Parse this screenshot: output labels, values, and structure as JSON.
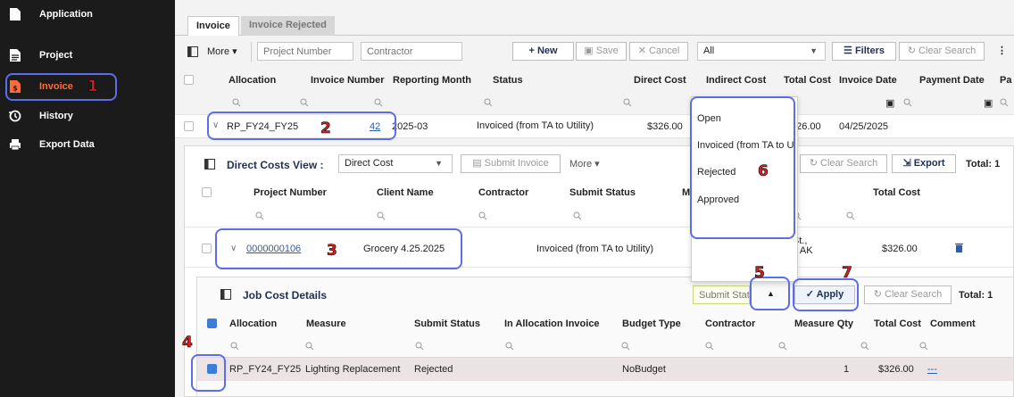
{
  "sidebar": {
    "items": [
      {
        "label": "Application",
        "icon": "document-icon"
      },
      {
        "label": "Project",
        "icon": "document-lines-icon"
      },
      {
        "label": "Invoice",
        "icon": "invoice-icon",
        "active": true
      },
      {
        "label": "History",
        "icon": "history-icon"
      },
      {
        "label": "Export Data",
        "icon": "export-icon"
      }
    ]
  },
  "tabs": [
    {
      "label": "Invoice"
    },
    {
      "label": "Invoice Rejected"
    }
  ],
  "toolbar": {
    "more": "More",
    "project_placeholder": "Project Number",
    "contractor_placeholder": "Contractor",
    "new": "New",
    "save": "Save",
    "cancel": "Cancel",
    "filter_select": "All",
    "filters": "Filters",
    "clear_search": "Clear Search"
  },
  "grid": {
    "headers": [
      "Allocation",
      "Invoice Number",
      "Reporting Month",
      "Status",
      "Direct Cost",
      "Indirect Cost",
      "Total Cost",
      "Invoice Date",
      "Payment Date",
      "Pa"
    ],
    "row": {
      "allocation": "RP_FY24_FY25",
      "invoice_number": "42",
      "reporting_month": "2025-03",
      "status": "Invoiced (from TA to Utility)",
      "direct_cost": "$326.00",
      "total_cost": "326.00",
      "invoice_date": "04/25/2025"
    }
  },
  "direct_costs": {
    "title": "Direct Costs View :",
    "view_select": "Direct Cost",
    "submit_invoice": "Submit Invoice",
    "more": "More",
    "clear_search": "Clear Search",
    "export": "Export",
    "total": "Total: 1",
    "headers": [
      "Project Number",
      "Client Name",
      "Contractor",
      "Submit Status",
      "M",
      "s",
      "Total Cost"
    ],
    "row": {
      "project_number": "0000000106",
      "client_name": "Grocery 4.25.2025",
      "submit_status": "Invoiced (from TA to Utility)",
      "address_line1": "rth St.,",
      "address_line2": "een, AK",
      "total_cost": "$326.00"
    }
  },
  "job_cost": {
    "title": "Job Cost Details",
    "status_placeholder": "Submit Statu",
    "apply": "Apply",
    "clear_search": "Clear Search",
    "total": "Total: 1",
    "headers": [
      "Allocation",
      "Measure",
      "Submit Status",
      "In Allocation Invoice",
      "Budget Type",
      "Contractor",
      "Measure Qty",
      "Total Cost",
      "Comment"
    ],
    "row": {
      "allocation": "RP_FY24_FY25",
      "measure": "Lighting Replacement",
      "submit_status": "Rejected",
      "budget_type": "NoBudget",
      "measure_qty": "1",
      "total_cost": "$326.00",
      "comment": "---"
    }
  },
  "dropdown": {
    "options": [
      "Open",
      "Invoiced (from TA to Ut",
      "Rejected",
      "Approved"
    ]
  },
  "annotations": [
    "1",
    "2",
    "3",
    "4",
    "5",
    "6",
    "7"
  ],
  "colors": {
    "sidebar_bg": "#1b1b1b",
    "active_nav": "#ff6a3c",
    "highlight": "#5b6de8",
    "badge": "#d62020",
    "primary_btn": "#1f4e9e",
    "checkbox": "#3b7dd8"
  }
}
